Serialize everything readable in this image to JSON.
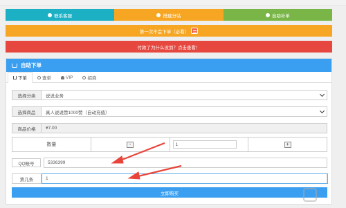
{
  "top_buttons": {
    "contact": "联系客服",
    "substation": "搭建分站",
    "cashout": "自助补单"
  },
  "banners": {
    "first_order": "第一次不会下单（必看）",
    "paid_not_arrived": "付款了为什么没到？点击查看！"
  },
  "panel": {
    "title": "自助下单",
    "tabs": [
      "下单",
      "查单",
      "VIP",
      "招商"
    ]
  },
  "form": {
    "category_label": "选择分类",
    "category_value": "说说业务",
    "product_label": "选择商品",
    "product_value": "真人说说赞1000赞（自动充值）",
    "price_label": "商品价格",
    "price_value": "¥7.00",
    "qty_label": "数量",
    "qty_minus": "-",
    "qty_value": "1",
    "qty_plus": "+",
    "qq_label": "QQ帐号",
    "qq_value": "5336399",
    "nth_label": "第几条",
    "nth_value": "1",
    "buy_label": "立即购买"
  },
  "colors": {
    "teal": "#1cb0c4",
    "orange": "#f6a623",
    "green": "#79b547",
    "red": "#e6473e",
    "blue": "#3a9ff0",
    "arrow": "#e8443a"
  },
  "watermark_logo": "WM"
}
